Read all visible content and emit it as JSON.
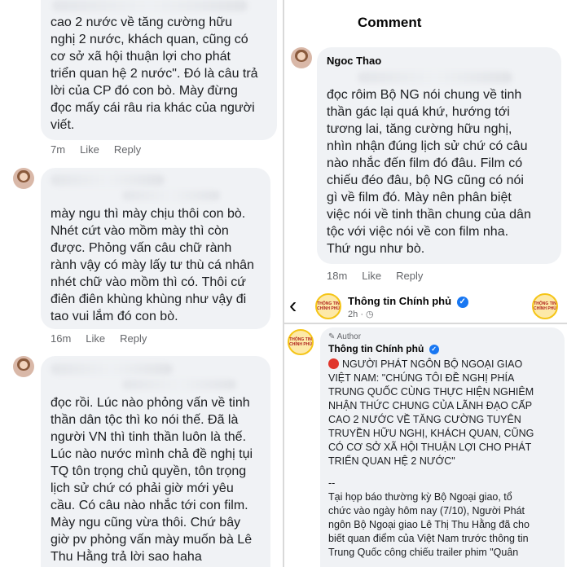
{
  "left_panel": {
    "comment1": {
      "lines": [
        "cao 2 nước  về tăng cường hữu",
        "nghị 2 nước, khách quan, cũng có",
        "cơ sở xã hội thuận lợi cho phát",
        "triển quan hệ 2 nước\". Đó là câu trả",
        "lời của CP đó con bò. Mày đừng",
        "đọc mấy cái râu ria khác của người",
        "viết."
      ],
      "time": "7m",
      "like": "Like",
      "reply": "Reply"
    },
    "comment2": {
      "lines": [
        "mày ngu thì mày chịu thôi con bò.",
        "Nhét cứt vào mồm mày thì còn",
        "được. Phỏng vấn câu chữ rành",
        "rành vậy có mày lấy tư thù cá nhân",
        "nhét chữ vào mồm thì có. Thôi cứ",
        "điên điên khùng khùng như vậy đi",
        "tao vui lắm đó con bò."
      ],
      "time": "16m",
      "like": "Like",
      "reply": "Reply"
    },
    "comment3": {
      "lines": [
        "đọc rồi. Lúc nào phỏng vấn về tinh",
        "thần dân tộc  thì ko nói thế. Đã là",
        "người VN thì tinh thần luôn là thế.",
        "Lúc nào nước mình chả đề nghị tụi",
        "TQ tôn trọng chủ quyền, tôn trọng",
        "lịch sử chứ có phải giờ mới yêu",
        "cầu. Có câu nào nhắc tới con film.",
        "Mày ngu cũng vừa thôi. Chứ bây",
        "giờ pv phỏng vấn mày muốn bà Lê",
        "Thu Hằng trả lời sao haha"
      ]
    }
  },
  "right_top": {
    "header": "Comment",
    "author": "Ngoc Thao",
    "lines": [
      "đọc rôim Bộ NG nói chung về tinh",
      "thần gác lại quá khứ, hướng tới",
      "tương lai, tăng cường hữu nghị,",
      "nhìn nhận đúng lịch sử chứ có câu",
      "nào nhắc đến film đó đâu. Film có",
      "chiếu đéo đâu, bộ NG cũng có nói",
      "gì về film đó. Mày nên phân biệt",
      "việc nói về tinh thần chung của dân",
      "tộc với việc nói về con film nha.",
      "Thứ ngu như bò."
    ],
    "time": "18m",
    "like": "Like",
    "reply": "Reply"
  },
  "right_page_bar": {
    "back_glyph": "‹",
    "page_name": "Thông tin Chính phủ",
    "time": "2h",
    "logo_text": "THÔNG TIN CHÍNH PHỦ"
  },
  "right_bottom": {
    "author_badge": "Author",
    "page_name": "Thông tin Chính phủ",
    "post_lines": [
      "NGƯỜI PHÁT NGÔN BỘ NGOẠI GIAO",
      "VIỆT NAM: \"CHÚNG TÔI ĐỀ NGHỊ PHÍA",
      "TRUNG QUỐC CÙNG THỰC HIỆN NGHIÊM",
      "NHẬN THỨC CHUNG CỦA LÃNH ĐẠO CẤP",
      "CAO 2 NƯỚC VỀ TĂNG CƯỜNG TUYÊN",
      "TRUYỀN HỮU NGHỊ, KHÁCH QUAN, CŨNG",
      "CÓ CƠ SỞ XÃ HỘI THUẬN LỢI CHO PHÁT",
      "TRIỂN QUAN HỆ 2 NƯỚC\""
    ],
    "separator": "--",
    "body_lines": [
      "Tại họp báo thường kỳ Bộ Ngoại giao, tổ",
      "chức vào ngày hôm nay (7/10), Người Phát",
      "ngôn Bộ Ngoại giao Lê Thị Thu Hằng đã cho",
      "biết quan điểm của Việt Nam trước thông tin",
      "Trung Quốc công chiếu trailer phim \"Quân"
    ]
  },
  "colors": {
    "bubble": "#f0f2f5",
    "meta": "#65676b",
    "verified": "#1877f2",
    "alert": "#e0362c"
  }
}
